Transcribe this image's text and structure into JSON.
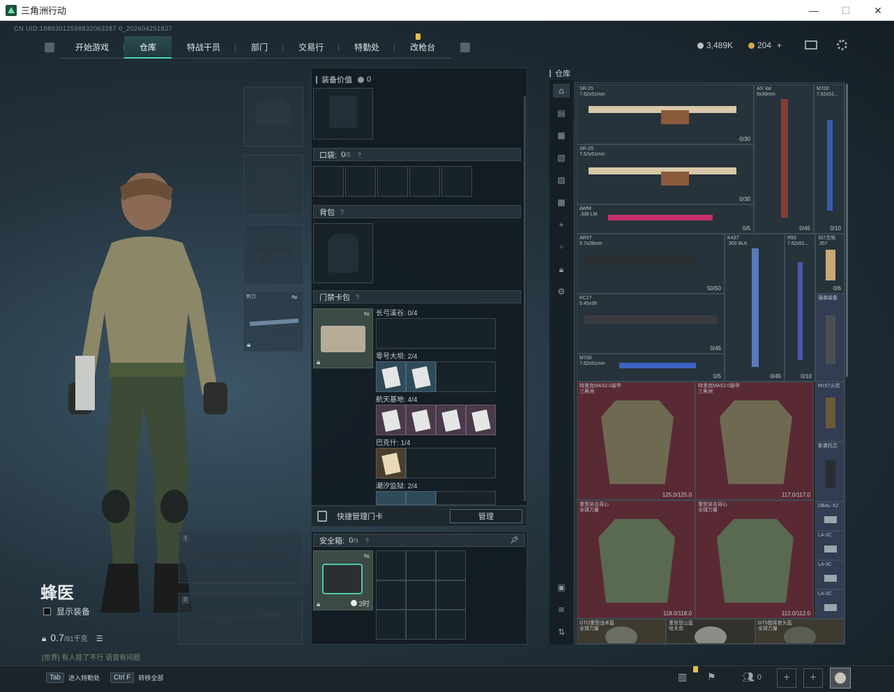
{
  "window": {
    "title": "三角洲行动",
    "minimize": "—",
    "maximize": "☐",
    "close": "✕"
  },
  "uid": "CN UID:18893012598832063287 0_202604251827",
  "nav": {
    "tabs": [
      "开始游戏",
      "仓库",
      "特战干员",
      "部门",
      "交易行",
      "特勤处",
      "改枪台"
    ],
    "active_index": 1
  },
  "currency": {
    "silver": "3,489K",
    "gold": "204",
    "plus": "+"
  },
  "character": {
    "name": "蜂医",
    "show_gear_label": "显示装备",
    "weight": "0.7",
    "weight_unit": "/81千克",
    "status_line": "[世界] 有人挂了不行 语音有问题",
    "melee_label": "刺刀",
    "slot1": "1",
    "slot2": "2"
  },
  "equipment": {
    "value_label": "装备价值",
    "value": "0",
    "pocket_label": "口袋:",
    "pocket_value": "0",
    "pocket_max": "/5",
    "backpack_label": "背包",
    "keycard_label": "门禁卡包",
    "maps": [
      {
        "name": "长弓溪谷: 0/4",
        "filled": 0
      },
      {
        "name": "零号大坝: 2/4",
        "filled": 2
      },
      {
        "name": "航天基地: 4/4",
        "filled": 4
      },
      {
        "name": "巴克什: 1/4",
        "filled": 1
      },
      {
        "name": "潮汐监狱: 2/4",
        "filled": 2
      }
    ],
    "quick_manage_label": "快捷管理门卡",
    "manage_button": "管理",
    "safebox_label": "安全箱:",
    "safebox_value": "0",
    "safebox_max": "/9",
    "safebox_timer": "3时"
  },
  "storage": {
    "title": "仓库",
    "weapons": [
      {
        "name": "SR-25",
        "cal": "7.62x51mm",
        "count": "0/30"
      },
      {
        "name": "SR-25",
        "cal": "7.62x51mm",
        "count": "0/30"
      },
      {
        "name": "AS Val",
        "cal": "9x39mm",
        "count": "0/45"
      },
      {
        "name": "M700",
        "cal": "7.62x51...",
        "count": "0/10"
      },
      {
        "name": "AWM",
        "cal": ".338 LM",
        "count": "0/5"
      },
      {
        "name": "AR57",
        "cal": "5.7x28mm",
        "count": "50/50"
      },
      {
        "name": "K437",
        "cal": ".300 BLK",
        "count": "0/45"
      },
      {
        "name": "R93",
        "cal": "7.62x51...",
        "count": "0/10"
      },
      {
        "name": "357左轮",
        "cal": ".357",
        "count": "0/6"
      },
      {
        "name": "KC17",
        "cal": "5.45x39",
        "count": "0/45"
      },
      {
        "name": "M700",
        "cal": "7.62x51mm",
        "count": "0/5"
      },
      {
        "name": "强袭装备",
        "cal": "",
        "count": ""
      }
    ],
    "armor": [
      {
        "name": "特里克MAS2.0装甲",
        "sub": "三角洲",
        "count": "125.0/125.0"
      },
      {
        "name": "特里克MAS2.0装甲",
        "sub": "三角洲",
        "count": "117.0/117.0"
      },
      {
        "name": "重型突击背心",
        "sub": "全球力量",
        "count": "118.0/118.0"
      },
      {
        "name": "重型突击背心",
        "sub": "全球力量",
        "count": "112.0/112.0"
      }
    ],
    "side_items": [
      "M157火控",
      "影袭托芯",
      "DBAL-X2",
      "LA-3C",
      "LA-3C",
      "LA-3C"
    ],
    "helmets": [
      {
        "name": "GTO重型战术盔",
        "sub": "全球力量"
      },
      {
        "name": "重型登山盔",
        "sub": "哈夫克"
      },
      {
        "name": "GT5指挥官头盔",
        "sub": "全球力量"
      }
    ]
  },
  "bottom": {
    "hint1_key": "Tab",
    "hint1": "进入特勤处",
    "hint2_key": "Ctrl F",
    "hint2": "转移全部",
    "friends": "0"
  },
  "colors": {
    "accent": "#4ed8b0",
    "armor_bg": "#5a2a34",
    "badge": "#e8c14a"
  }
}
